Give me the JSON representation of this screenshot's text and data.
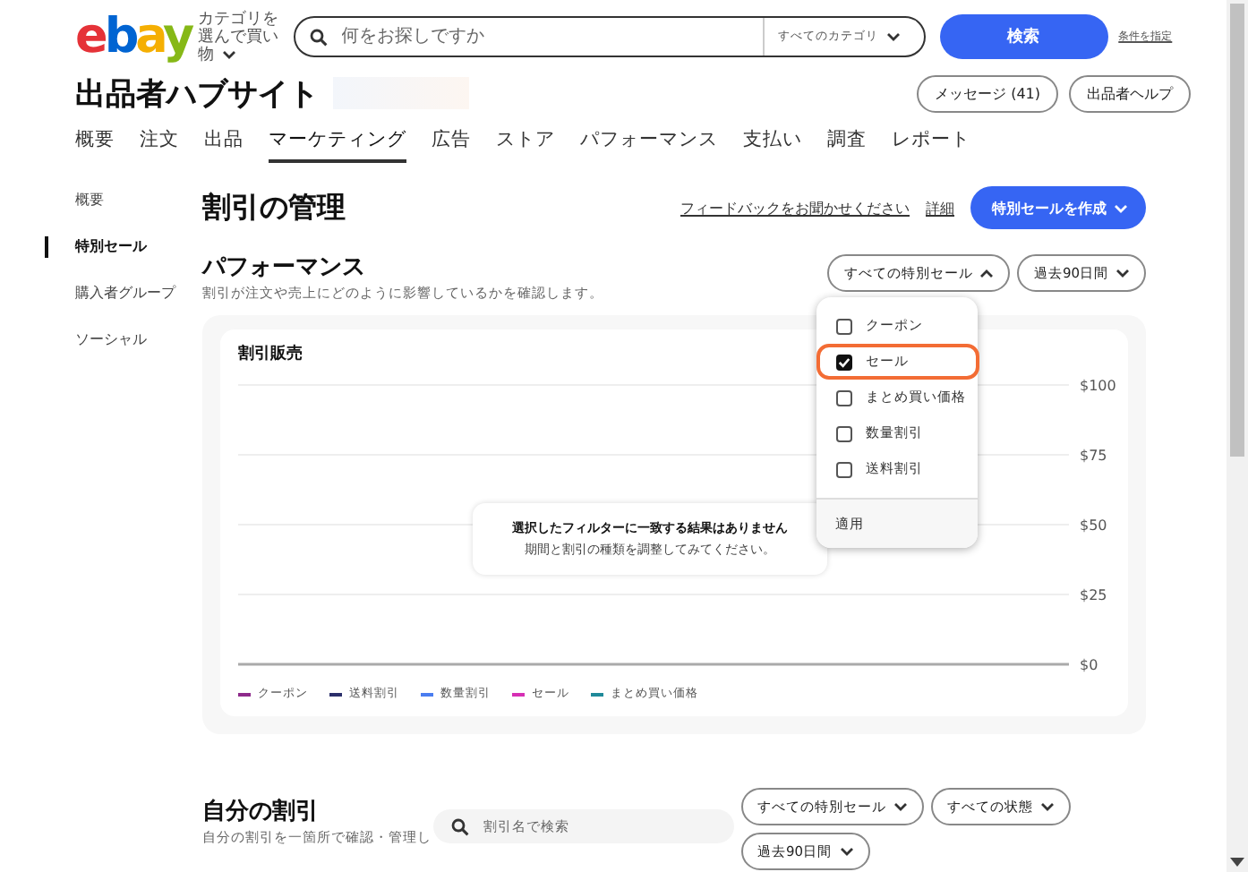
{
  "header": {
    "logo": "ebay",
    "category_shortcut": "カテゴリを選んで買い物",
    "search": {
      "placeholder": "何をお探しですか",
      "category": "すべてのカテゴリ"
    },
    "search_button": "検索",
    "advanced_link": "条件を指定"
  },
  "hub": {
    "title": "出品者ハブサイト",
    "buttons": [
      "メッセージ (41)",
      "出品者ヘルプ"
    ]
  },
  "nav_tabs": [
    {
      "label": "概要",
      "selected": false
    },
    {
      "label": "注文",
      "selected": false
    },
    {
      "label": "出品",
      "selected": false
    },
    {
      "label": "マーケティング",
      "selected": true
    },
    {
      "label": "広告",
      "selected": false
    },
    {
      "label": "ストア",
      "selected": false
    },
    {
      "label": "パフォーマンス",
      "selected": false
    },
    {
      "label": "支払い",
      "selected": false
    },
    {
      "label": "調査",
      "selected": false
    },
    {
      "label": "レポート",
      "selected": false
    }
  ],
  "sidebar": {
    "items": [
      {
        "label": "概要",
        "selected": false
      },
      {
        "label": "特別セール",
        "selected": true
      },
      {
        "label": "購入者グループ",
        "selected": false
      },
      {
        "label": "ソーシャル",
        "selected": false
      }
    ]
  },
  "page": {
    "title": "割引の管理",
    "feedback_link": "フィードバックをお聞かせください",
    "details_link": "詳細",
    "create_button": "特別セールを作成"
  },
  "performance": {
    "title": "パフォーマンス",
    "subtitle": "割引が注文や売上にどのように影響しているかを確認します。",
    "filters": [
      {
        "label": "すべての特別セール",
        "expanded": true
      },
      {
        "label": "過去90日間",
        "expanded": false
      }
    ],
    "dropdown": {
      "options": [
        {
          "label": "クーポン",
          "checked": false,
          "highlighted": false
        },
        {
          "label": "セール",
          "checked": true,
          "highlighted": true
        },
        {
          "label": "まとめ買い価格",
          "checked": false,
          "highlighted": false
        },
        {
          "label": "数量割引",
          "checked": false,
          "highlighted": false
        },
        {
          "label": "送料割引",
          "checked": false,
          "highlighted": false
        }
      ],
      "apply": "適用"
    },
    "empty_message": {
      "title": "選択したフィルターに一致する結果はありません",
      "detail": "期間と割引の種類を調整してみてください。"
    },
    "chart_data": {
      "type": "line",
      "title": "割引販売",
      "grid": true,
      "ylim": [
        0,
        100
      ],
      "yticks": [
        {
          "value": 0,
          "label": "$0"
        },
        {
          "value": 25,
          "label": "$25"
        },
        {
          "value": 50,
          "label": "$50"
        },
        {
          "value": 75,
          "label": "$75"
        },
        {
          "value": 100,
          "label": "$100"
        }
      ],
      "series": [
        {
          "name": "クーポン",
          "color": "#8e2a8b"
        },
        {
          "name": "送料割引",
          "color": "#2b2f6b"
        },
        {
          "name": "数量割引",
          "color": "#4a7df0"
        },
        {
          "name": "セール",
          "color": "#d62fb4"
        },
        {
          "name": "まとめ買い価格",
          "color": "#1f8a9a"
        }
      ]
    }
  },
  "my_discounts": {
    "title": "自分の割引",
    "subtitle": "自分の割引を一箇所で確認・管理し",
    "search": {
      "placeholder": "割引名で検索"
    },
    "filters": [
      "すべての特別セール",
      "すべての状態",
      "過去90日間"
    ]
  }
}
